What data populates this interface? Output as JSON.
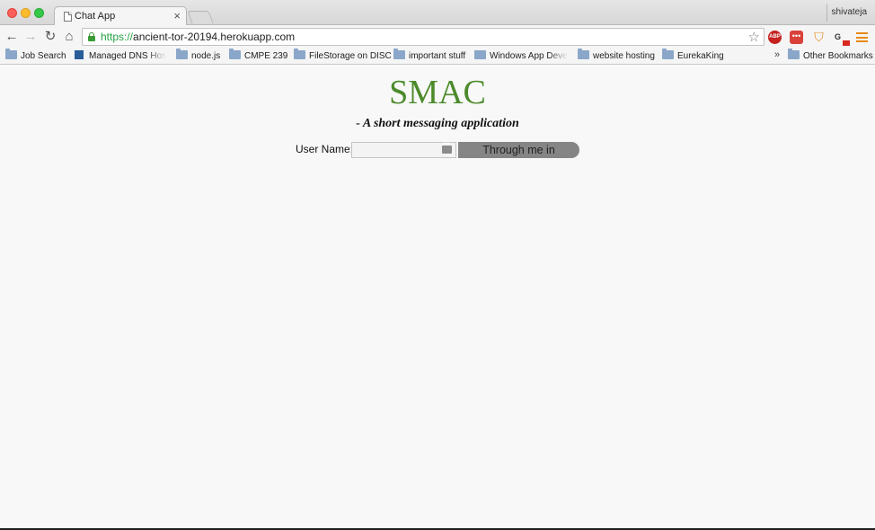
{
  "browser": {
    "tab_title": "Chat App",
    "tab_close": "×",
    "profile_name": "shivateja",
    "url_scheme": "https://",
    "url_rest": "ancient-tor-20194.herokuapp.com",
    "nav_icons": {
      "back": "←",
      "forward": "→",
      "reload": "↻",
      "home": "⌂",
      "star": "☆"
    },
    "extensions": {
      "abp": "ABP",
      "dots": "•••",
      "shield": "⛉",
      "ge": "G"
    }
  },
  "bookmarks": {
    "items": [
      {
        "label": "Job Search",
        "icon": "folder-icon"
      },
      {
        "label": "Managed DNS Hostin",
        "icon": "dns-icon"
      },
      {
        "label": "node.js",
        "icon": "folder-icon"
      },
      {
        "label": "CMPE 239",
        "icon": "folder-icon"
      },
      {
        "label": "FileStorage on DISC",
        "icon": "folder-icon"
      },
      {
        "label": "important stuff",
        "icon": "folder-icon"
      },
      {
        "label": "Windows App Develo",
        "icon": "folder-icon"
      },
      {
        "label": "website hosting",
        "icon": "folder-icon"
      },
      {
        "label": "EurekaKing",
        "icon": "folder-icon"
      }
    ],
    "overflow": "»",
    "other": "Other Bookmarks"
  },
  "page": {
    "title": "SMAC",
    "tagline": "- A short messaging application",
    "username_label": "User Name:",
    "username_value": "",
    "submit_label": "Through me in"
  },
  "colors": {
    "title": "#4c8a2a",
    "button": "#858585",
    "secure": "#24a144"
  }
}
